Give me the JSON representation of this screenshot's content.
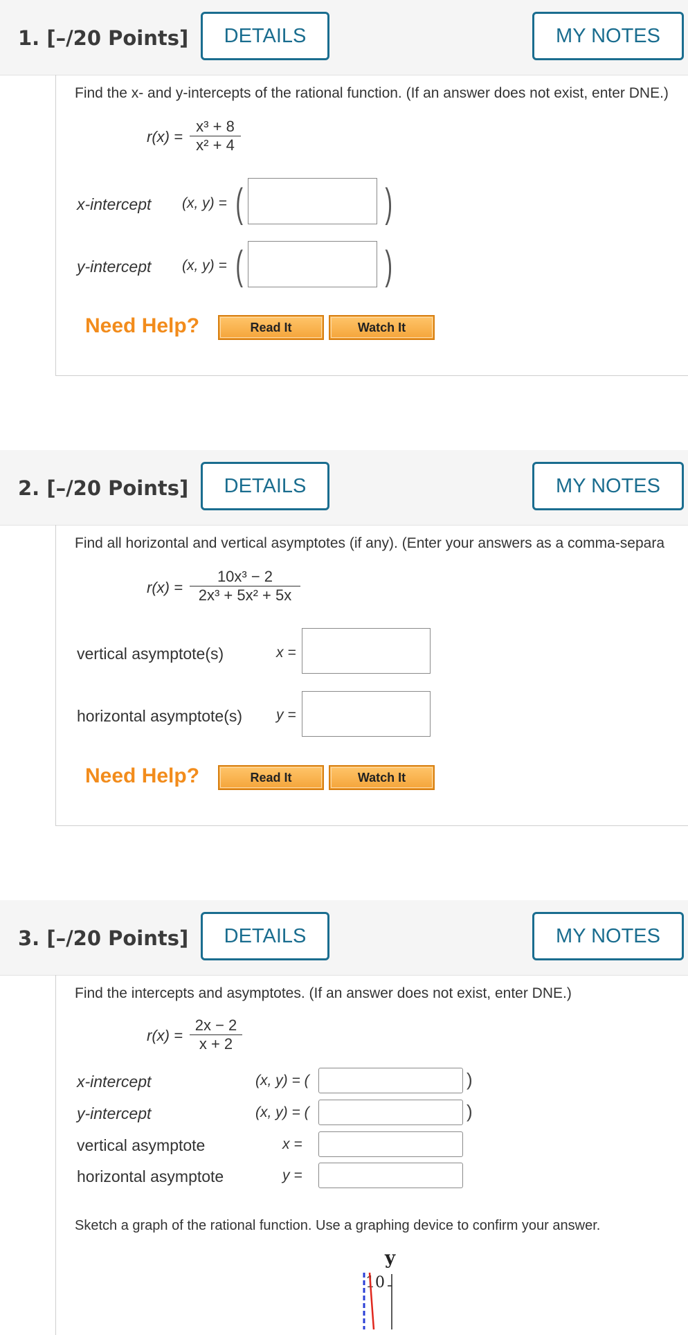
{
  "questions": [
    {
      "number": "1.",
      "points": "[–/20 Points]",
      "details_label": "DETAILS",
      "notes_label": "MY NOTES",
      "prompt": "Find the x- and y-intercepts of the rational function. (If an answer does not exist, enter DNE.)",
      "function_lhs": "r(x) =",
      "numerator": "x³ + 8",
      "denominator": "x² + 4",
      "fields": [
        {
          "label": "x-intercept",
          "prefix": "(x, y) =",
          "value": ""
        },
        {
          "label": "y-intercept",
          "prefix": "(x, y) =",
          "value": ""
        }
      ]
    },
    {
      "number": "2.",
      "points": "[–/20 Points]",
      "details_label": "DETAILS",
      "notes_label": "MY NOTES",
      "prompt": "Find all horizontal and vertical asymptotes (if any). (Enter your answers as a comma-separa",
      "function_lhs": "r(x) =",
      "numerator": "10x³ − 2",
      "denominator": "2x³ + 5x² + 5x",
      "fields": [
        {
          "label": "vertical asymptote(s)",
          "prefix": "x =",
          "value": ""
        },
        {
          "label": "horizontal asymptote(s)",
          "prefix": "y =",
          "value": ""
        }
      ]
    },
    {
      "number": "3.",
      "points": "[–/20 Points]",
      "details_label": "DETAILS",
      "notes_label": "MY NOTES",
      "prompt": "Find the intercepts and asymptotes. (If an answer does not exist, enter DNE.)",
      "function_lhs": "r(x) =",
      "numerator": "2x − 2",
      "denominator": "x + 2",
      "fields": [
        {
          "label": "x-intercept",
          "prefix": "(x, y) = (",
          "value": ""
        },
        {
          "label": "y-intercept",
          "prefix": "(x, y) = (",
          "value": ""
        },
        {
          "label": "vertical asymptote",
          "prefix": "x =",
          "value": ""
        },
        {
          "label": "horizontal asymptote",
          "prefix": "y =",
          "value": ""
        }
      ],
      "sketch_prompt": "Sketch a graph of the rational function. Use a graphing device to confirm your answer.",
      "graph": {
        "axis_label": "y",
        "tick_label": "10"
      }
    }
  ],
  "help": {
    "need_help": "Need Help?",
    "read_it": "Read It",
    "watch_it": "Watch It"
  },
  "colors": {
    "accent": "#1a6d8f",
    "need_help": "#f28c1c",
    "help_button": "#f4a43a"
  }
}
